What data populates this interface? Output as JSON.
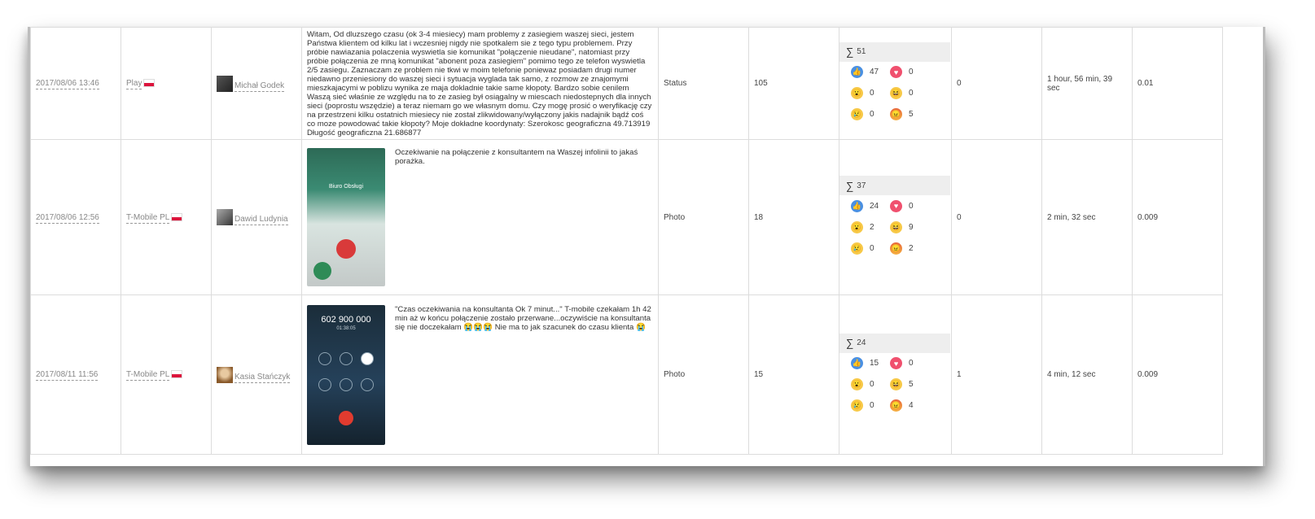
{
  "rows": [
    {
      "date": "2017/08/06 13:46",
      "page": "Play",
      "author": "Michał Godek",
      "message": "Witam, Od dluzszego czasu (ok 3-4 miesiecy) mam problemy z zasiegiem waszej sieci, jestem Państwa klientem od kilku lat i wczesniej nigdy nie spotkalem sie z tego typu problemem. Przy próbie nawiazania polaczenia wyswietla sie komunikat \"połączenie nieudane\", natomiast przy próbie połączenia ze mną komunikat \"abonent poza zasiegiem\" pomimo tego ze telefon wyswietla 2/5 zasiegu. Zaznaczam ze problem nie tkwi w moim telefonie poniewaz posiadam drugi numer niedawno przeniesiony do waszej sieci i sytuacja wyglada tak samo, z rozmow ze znajomymi mieszkajacymi w poblizu wynika ze maja dokladnie takie same kłopoty. Bardzo sobie cenilem Waszą sieć właśnie ze względu na to ze zasieg był osiągalny w miescach niedostepnych dla innych sieci (poprostu wszędzie) a teraz niemam go we własnym domu. Czy mogę prosić o weryfikację czy na przestrzeni kilku ostatnich miesiecy nie został zlikwidowany/wyłączony jakis nadajnik bądź coś co moze powodować takie kłopoty? Moje dokładne koordynaty: Szerokosc geograficzna 49.713919 Długość geograficzna 21.686877",
      "type": "Status",
      "count": "105",
      "reactions": {
        "total": "51",
        "like": "47",
        "love": "0",
        "wow": "0",
        "haha": "0",
        "sad": "0",
        "angry": "5"
      },
      "comments": "0",
      "response_time": "1 hour, 56 min, 39 sec",
      "rate": "0.01"
    },
    {
      "date": "2017/08/06 12:56",
      "page": "T-Mobile PL",
      "author": "Dawid Ludynia",
      "message": "Oczekiwanie na połączenie z konsultantem na Waszej infolinii to jakaś porażka.",
      "type": "Photo",
      "count": "18",
      "reactions": {
        "total": "37",
        "like": "24",
        "love": "0",
        "wow": "2",
        "haha": "9",
        "sad": "0",
        "angry": "2"
      },
      "comments": "0",
      "response_time": "2 min, 32 sec",
      "rate": "0.009"
    },
    {
      "date": "2017/08/11 11:56",
      "page": "T-Mobile PL",
      "author": "Kasia Stańczyk",
      "message": "\"Czas oczekiwania na konsultanta Ok 7 minut...\" T-mobile czekałam 1h 42 min aż w końcu połączenie zostało przerwane...oczywiście na konsultanta się nie doczekałam 😭😭😭 Nie ma to jak szacunek do czasu klienta 😭",
      "type": "Photo",
      "count": "15",
      "reactions": {
        "total": "24",
        "like": "15",
        "love": "0",
        "wow": "0",
        "haha": "5",
        "sad": "0",
        "angry": "4"
      },
      "comments": "1",
      "response_time": "4 min, 12 sec",
      "rate": "0.009"
    }
  ],
  "photo_screens": {
    "row2_title": "Biuro Obsługi",
    "row3_number": "602 900 000",
    "row3_time": "01:38:05"
  },
  "icons": {
    "total": "sigma-icon",
    "like": "thumbs-up-icon",
    "love": "heart-icon",
    "wow": "wow-face-icon",
    "haha": "laugh-face-icon",
    "sad": "sad-face-icon",
    "angry": "angry-face-icon"
  },
  "colors": {
    "flag_red": "#dc143c",
    "like_blue": "#4a90e2",
    "love_red": "#f0506e"
  }
}
